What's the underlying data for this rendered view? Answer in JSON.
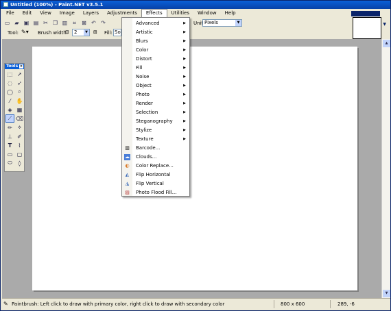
{
  "window": {
    "title": "Untitled (100%) - Paint.NET v3.5.1"
  },
  "menubar": [
    "File",
    "Edit",
    "View",
    "Image",
    "Layers",
    "Adjustments",
    "Effects",
    "Utilities",
    "Window",
    "Help"
  ],
  "toolbar": {
    "units_label": "Units:",
    "units_value": "Pixels",
    "tool_label": "Tool:",
    "brush_width_label": "Brush width:",
    "brush_width_value": "2",
    "fill_label": "Fill:",
    "fill_value": "Sol"
  },
  "tools_panel": {
    "title": "Tools",
    "icons": [
      "rect-select-icon",
      "move-selection-icon",
      "lasso-icon",
      "move-selected-icon",
      "ellipse-select-icon",
      "zoom-icon",
      "magic-wand-icon",
      "pan-icon",
      "paint-bucket-icon",
      "gradient-icon",
      "paintbrush-icon",
      "eraser-icon",
      "pencil-icon",
      "color-picker-icon",
      "clone-stamp-icon",
      "recolor-icon",
      "text-icon",
      "line-curve-icon",
      "rectangle-icon",
      "rounded-rectangle-icon",
      "ellipse-icon",
      "freeform-shape-icon"
    ]
  },
  "effects_menu": {
    "items": [
      {
        "label": "Advanced",
        "submenu": true
      },
      {
        "label": "Artistic",
        "submenu": true
      },
      {
        "label": "Blurs",
        "submenu": true
      },
      {
        "label": "Color",
        "submenu": true
      },
      {
        "label": "Distort",
        "submenu": true
      },
      {
        "label": "Fill",
        "submenu": true
      },
      {
        "label": "Noise",
        "submenu": true
      },
      {
        "label": "Object",
        "submenu": true
      },
      {
        "label": "Photo",
        "submenu": true
      },
      {
        "label": "Render",
        "submenu": true
      },
      {
        "label": "Selection",
        "submenu": true
      },
      {
        "label": "Steganography",
        "submenu": true
      },
      {
        "label": "Stylize",
        "submenu": true
      },
      {
        "label": "Texture",
        "submenu": true
      },
      {
        "label": "Barcode...",
        "submenu": false,
        "icon": "barcode-icon"
      },
      {
        "label": "Clouds...",
        "submenu": false,
        "icon": "clouds-icon"
      },
      {
        "label": "Color Replace...",
        "submenu": false,
        "icon": "color-replace-icon"
      },
      {
        "label": "Flip Horizontal",
        "submenu": false,
        "icon": "flip-horizontal-icon"
      },
      {
        "label": "Flip Vertical",
        "submenu": false,
        "icon": "flip-vertical-icon"
      },
      {
        "label": "Photo Flood Fill...",
        "submenu": false,
        "icon": "photo-flood-fill-icon"
      }
    ]
  },
  "statusbar": {
    "hint": "Paintbrush: Left click to draw with primary color, right click to draw with secondary color",
    "image_size": "800 x 600",
    "cursor_position": "289, -6"
  },
  "colors": {
    "titlebar": "#0a5fd8",
    "workspace": "#aaaaaa",
    "selection": "#c1d3fb"
  }
}
